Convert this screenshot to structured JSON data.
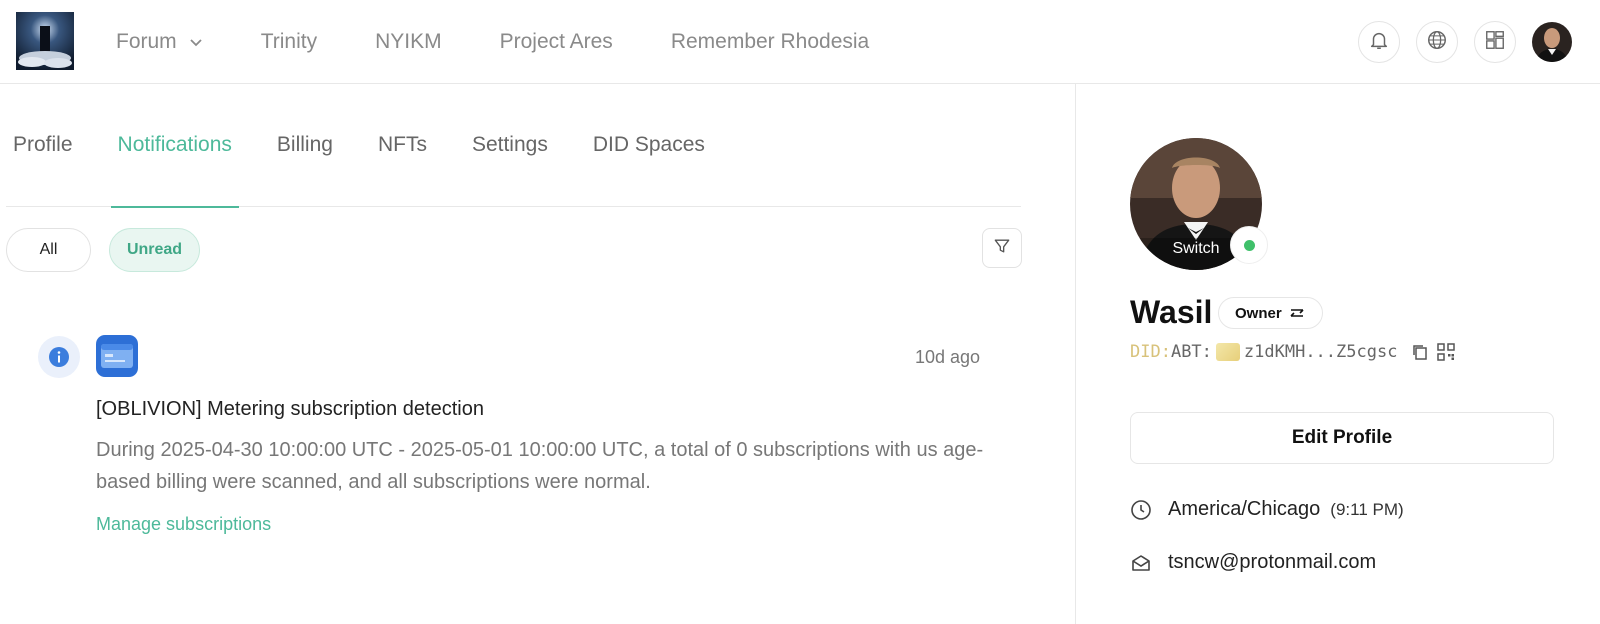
{
  "nav": {
    "items": [
      {
        "label": "Forum",
        "has_dropdown": true
      },
      {
        "label": "Trinity"
      },
      {
        "label": "NYIKM"
      },
      {
        "label": "Project Ares"
      },
      {
        "label": "Remember Rhodesia"
      }
    ]
  },
  "top_icons": [
    "bell-icon",
    "globe-icon",
    "apps-grid-icon"
  ],
  "tabs": [
    {
      "label": "Profile",
      "active": false
    },
    {
      "label": "Notifications",
      "active": true
    },
    {
      "label": "Billing",
      "active": false
    },
    {
      "label": "NFTs",
      "active": false
    },
    {
      "label": "Settings",
      "active": false
    },
    {
      "label": "DID Spaces",
      "active": false
    }
  ],
  "filters": {
    "all": "All",
    "unread": "Unread",
    "selected": "Unread"
  },
  "notification": {
    "time": "10d ago",
    "title": "[OBLIVION] Metering subscription detection",
    "body": "During 2025-04-30 10:00:00 UTC - 2025-05-01 10:00:00 UTC, a total of 0 subscriptions with us age-based billing were scanned, and all subscriptions were normal.",
    "link": "Manage subscriptions"
  },
  "profile": {
    "switch_label": "Switch",
    "name": "Wasil",
    "role": "Owner",
    "did_prefix": "DID:",
    "did_chain": "ABT:",
    "did_value": "z1dKMH...Z5cgsc",
    "edit_button": "Edit Profile",
    "timezone": "America/Chicago",
    "local_time": "(9:11 PM)",
    "email": "tsncw@protonmail.com",
    "online": true
  },
  "colors": {
    "accent": "#4db99a",
    "info_blue": "#3b7ddd",
    "online_green": "#3fc06a"
  }
}
